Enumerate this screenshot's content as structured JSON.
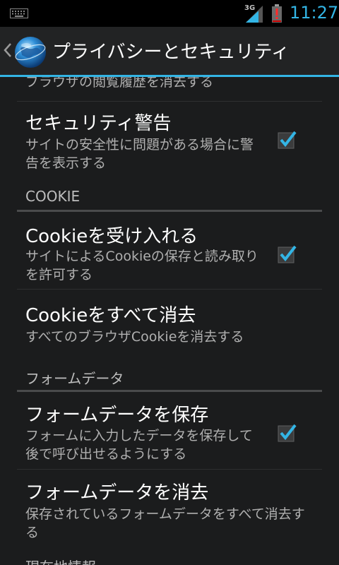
{
  "status_bar": {
    "network_label": "3G",
    "time": "11:27",
    "accent": "#33b5e5"
  },
  "action_bar": {
    "title": "プライバシーとセキュリティ"
  },
  "list": {
    "partial_top_summary": "ブラウザの閲覧履歴を消去する",
    "security_warning": {
      "title": "セキュリティ警告",
      "summary": "サイトの安全性に問題がある場合に警告を表示する",
      "checked": true
    },
    "cookie_category": "COOKIE",
    "accept_cookies": {
      "title": "Cookieを受け入れる",
      "summary": "サイトによるCookieの保存と読み取りを許可する",
      "checked": true
    },
    "clear_cookies": {
      "title": "Cookieをすべて消去",
      "summary": "すべてのブラウザCookieを消去する"
    },
    "form_category": "フォームデータ",
    "save_form_data": {
      "title": "フォームデータを保存",
      "summary": "フォームに入力したデータを保存して後で呼び出せるようにする",
      "checked": true
    },
    "clear_form_data": {
      "title": "フォームデータを消去",
      "summary": "保存されているフォームデータをすべて消去する"
    },
    "partial_bottom_category": "現在地情報"
  }
}
